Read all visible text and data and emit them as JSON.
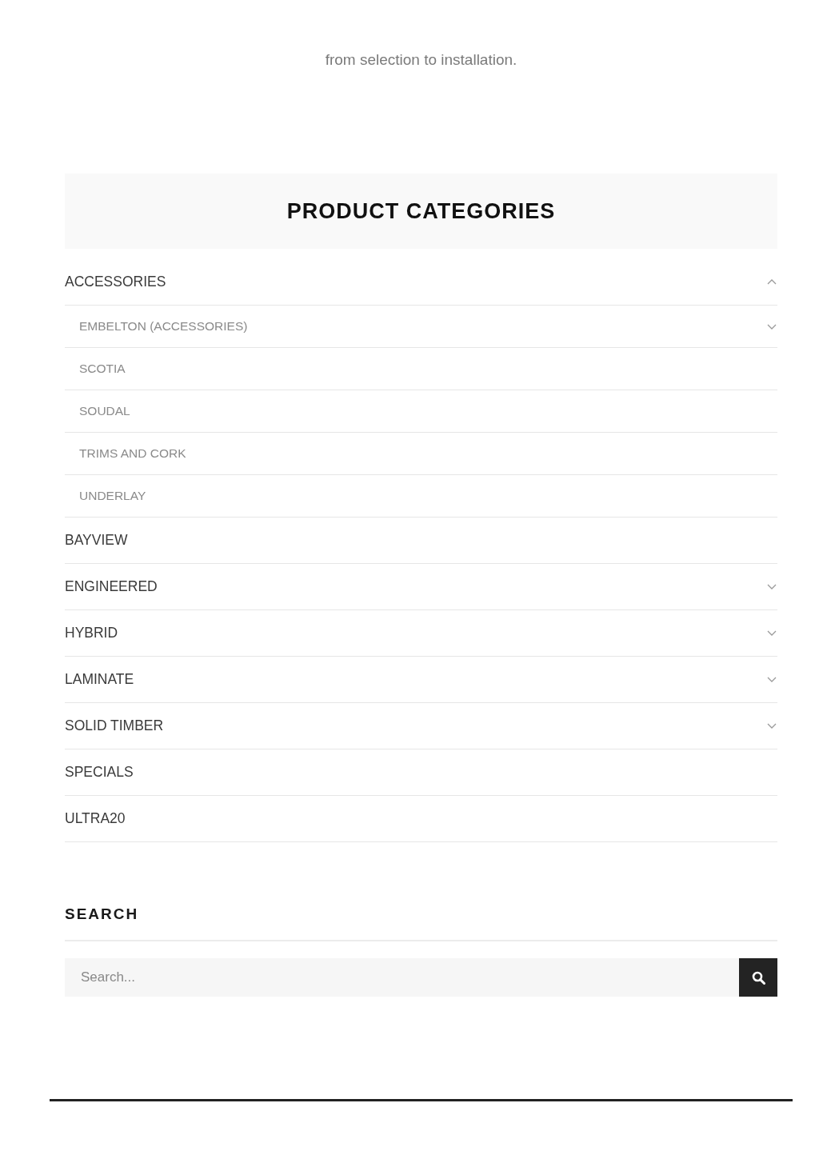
{
  "intro": {
    "text": "from selection to installation."
  },
  "categories": {
    "title": "PRODUCT CATEGORIES",
    "items": [
      {
        "label": "ACCESSORIES",
        "expanded": true,
        "children": [
          {
            "label": "EMBELTON (ACCESSORIES)",
            "expanded": false
          },
          {
            "label": "SCOTIA"
          },
          {
            "label": "SOUDAL"
          },
          {
            "label": "TRIMS AND CORK"
          },
          {
            "label": "UNDERLAY"
          }
        ]
      },
      {
        "label": "BAYVIEW"
      },
      {
        "label": "ENGINEERED",
        "expanded": false
      },
      {
        "label": "HYBRID",
        "expanded": false
      },
      {
        "label": "LAMINATE",
        "expanded": false
      },
      {
        "label": "SOLID TIMBER",
        "expanded": false
      },
      {
        "label": "SPECIALS"
      },
      {
        "label": "ULTRA20"
      }
    ]
  },
  "search": {
    "title": "SEARCH",
    "placeholder": "Search..."
  }
}
